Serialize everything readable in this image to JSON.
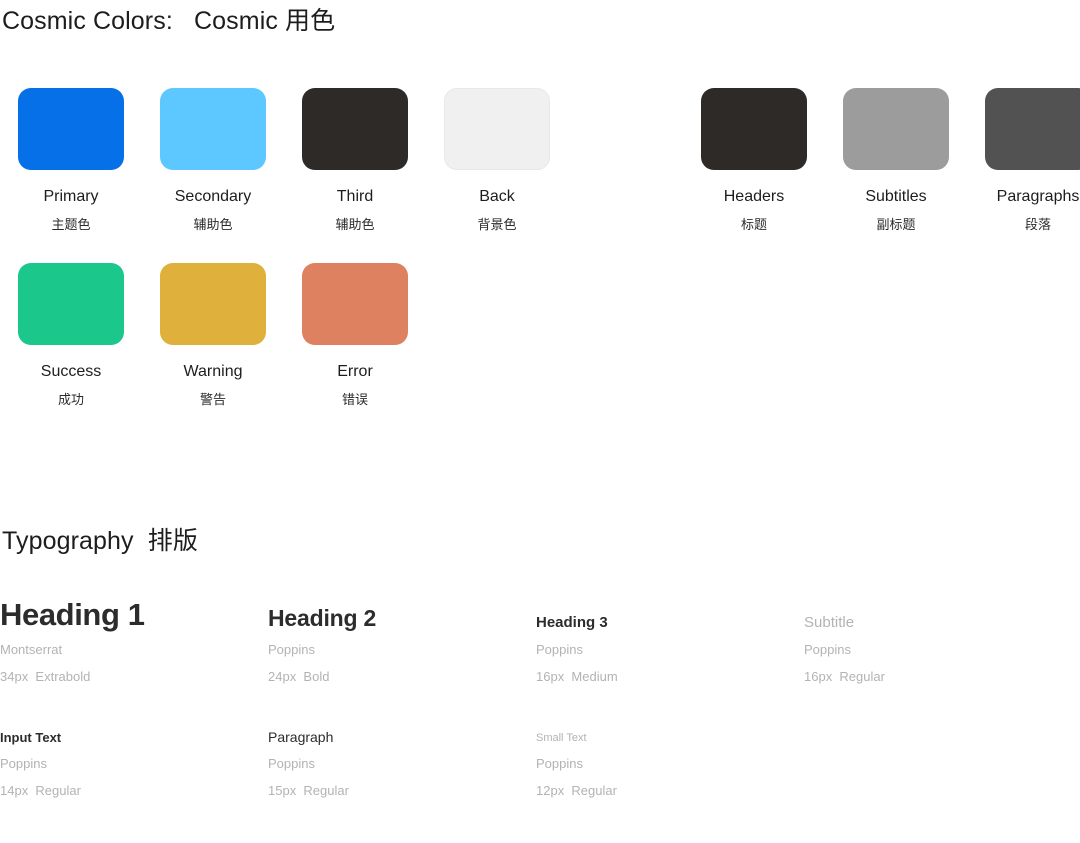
{
  "sections": {
    "colors": {
      "title": "Cosmic Colors:   Cosmic 用色"
    },
    "typography": {
      "title": "Typography  排版"
    }
  },
  "palette_left": [
    {
      "name": "Primary",
      "cn": "主题色",
      "hex": "#0670e8",
      "border": "none"
    },
    {
      "name": "Secondary",
      "cn": "辅助色",
      "hex": "#5cc8ff",
      "border": "none"
    },
    {
      "name": "Third",
      "cn": "辅助色",
      "hex": "#2e2a28",
      "border": "none"
    },
    {
      "name": "Back",
      "cn": "背景色",
      "hex": "#f0f0f0",
      "border": "1px solid #e8e8e8"
    }
  ],
  "palette_right": [
    {
      "name": "Headers",
      "cn": "标题",
      "hex": "#2e2a28",
      "border": "none"
    },
    {
      "name": "Subtitles",
      "cn": "副标题",
      "hex": "#9c9c9c",
      "border": "none"
    },
    {
      "name": "Paragraphs",
      "cn": "段落",
      "hex": "#525252",
      "border": "none"
    }
  ],
  "palette_status": [
    {
      "name": "Success",
      "cn": "成功",
      "hex": "#1cc78b",
      "border": "none"
    },
    {
      "name": "Warning",
      "cn": "警告",
      "hex": "#e0b03c",
      "border": "none"
    },
    {
      "name": "Error",
      "cn": "错误",
      "hex": "#de8161",
      "border": "none"
    }
  ],
  "type_row_1": [
    {
      "sample": "Heading 1",
      "font": "Montserrat",
      "spec": "34px  Extrabold",
      "style": "s-h1"
    },
    {
      "sample": "Heading 2",
      "font": "Poppins",
      "spec": "24px  Bold",
      "style": "s-h2"
    },
    {
      "sample": "Heading 3",
      "font": "Poppins",
      "spec": "16px  Medium",
      "style": "s-h3"
    },
    {
      "sample": "Subtitle",
      "font": "Poppins",
      "spec": "16px  Regular",
      "style": "s-subtitle"
    }
  ],
  "type_row_2": [
    {
      "sample": "Input Text",
      "font": "Poppins",
      "spec": "14px  Regular",
      "style": "s-input"
    },
    {
      "sample": "Paragraph",
      "font": "Poppins",
      "spec": "15px  Regular",
      "style": "s-paragraph"
    },
    {
      "sample": "Small Text",
      "font": "Poppins",
      "spec": "12px  Regular",
      "style": "s-small"
    }
  ]
}
